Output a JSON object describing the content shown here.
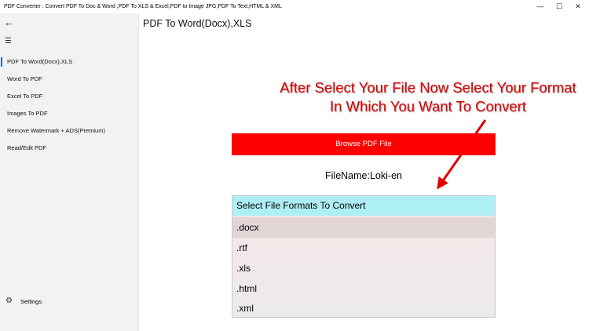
{
  "window": {
    "title": "PDF Converter : Convert PDF To Doc & Word ,PDF To XLS & Excel,PDF to Image JPG,PDF To Text,HTML & XML",
    "minimize_glyph": "—",
    "maximize_glyph": "☐",
    "close_glyph": "✕"
  },
  "sidebar": {
    "back_glyph": "←",
    "menu_glyph": "☰",
    "items": [
      {
        "label": "PDF To Word(Docx),XLS",
        "selected": true
      },
      {
        "label": "Word To PDF"
      },
      {
        "label": "Excel To PDF"
      },
      {
        "label": "Images To PDF"
      },
      {
        "label": "Remove Watermark + ADS(Premium)"
      },
      {
        "label": "Read/Edit PDF"
      }
    ],
    "settings": {
      "label": "Settings",
      "icon": "gear-icon",
      "glyph": "⚙"
    }
  },
  "main": {
    "page_title": "PDF To Word(Docx),XLS",
    "annotation": {
      "line1": "After Select Your File Now Select Your Format",
      "line2": "In Which You Want To Convert",
      "color": "#e00000"
    },
    "browse_label": "Browse PDF File",
    "filename": "FileName:Loki-en",
    "formats": {
      "header": "Select File Formats To Convert",
      "options": [
        ".docx",
        ".rtf",
        ".xls",
        ".html",
        ".xml"
      ],
      "selected": ".docx"
    }
  },
  "colors": {
    "accent": "#ff0000",
    "header_bg": "#aeeef5",
    "sidebar_bg": "#f2f2f2",
    "selection_indicator": "#2a64c5"
  }
}
